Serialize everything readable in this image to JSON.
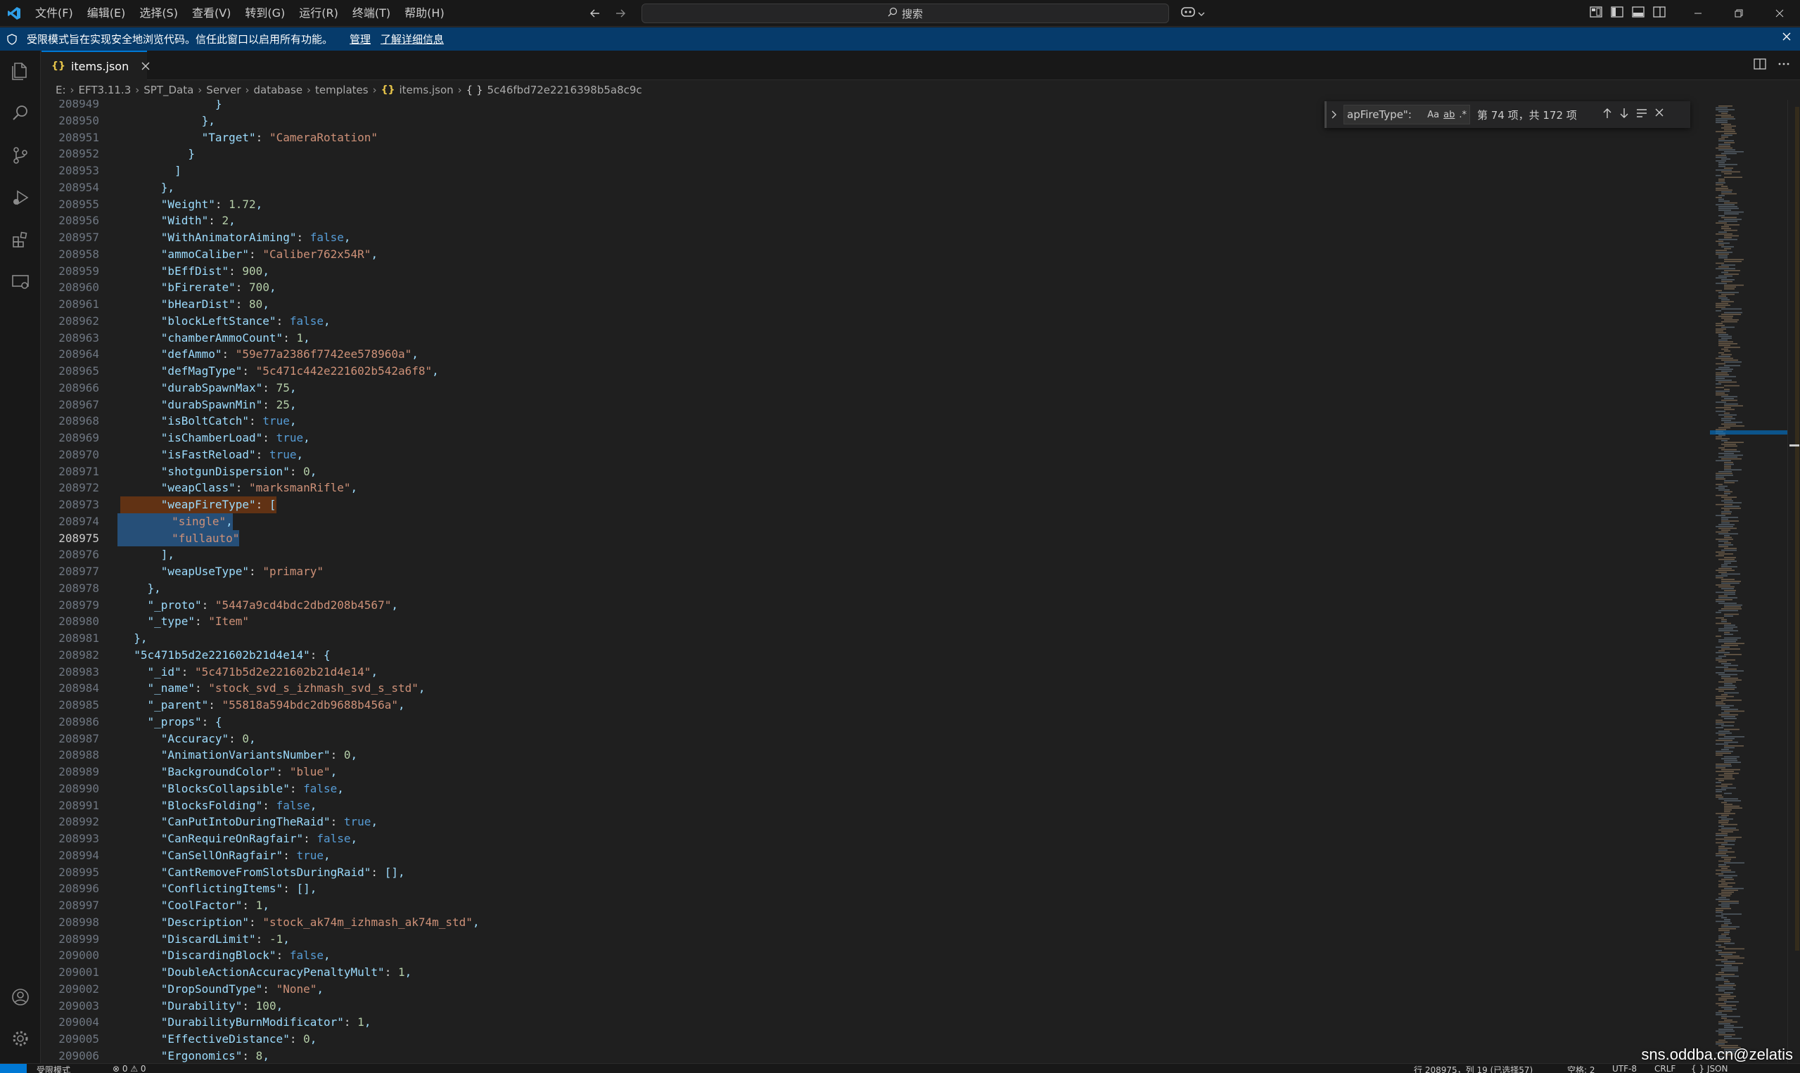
{
  "titlebar": {
    "menu": [
      "文件(F)",
      "编辑(E)",
      "选择(S)",
      "查看(V)",
      "转到(G)",
      "运行(R)",
      "终端(T)",
      "帮助(H)"
    ],
    "search_label": "搜索"
  },
  "banner": {
    "message": "受限模式旨在实现安全地浏览代码。信任此窗口以启用所有功能。",
    "manage": "管理",
    "learn_more": "了解详细信息"
  },
  "tab": {
    "label": "items.json"
  },
  "breadcrumb": {
    "items": [
      "E:",
      "EFT3.11.3",
      "SPT_Data",
      "Server",
      "database",
      "templates",
      "items.json",
      "5c46fbd72e2216398b5a8c9c"
    ]
  },
  "find": {
    "query": "apFireType\":",
    "options": [
      "Aa",
      "ab",
      ".*"
    ],
    "count": "第 74 项，共 172 项"
  },
  "editor": {
    "current_line": "208975",
    "lines": [
      {
        "n": "208949",
        "t": "              }"
      },
      {
        "n": "208950",
        "t": "            },"
      },
      {
        "n": "208951",
        "t": "            \"Target\": \"CameraRotation\""
      },
      {
        "n": "208952",
        "t": "          }"
      },
      {
        "n": "208953",
        "t": "        ]"
      },
      {
        "n": "208954",
        "t": "      },"
      },
      {
        "n": "208955",
        "t": "      \"Weight\": 1.72,"
      },
      {
        "n": "208956",
        "t": "      \"Width\": 2,"
      },
      {
        "n": "208957",
        "t": "      \"WithAnimatorAiming\": false,"
      },
      {
        "n": "208958",
        "t": "      \"ammoCaliber\": \"Caliber762x54R\","
      },
      {
        "n": "208959",
        "t": "      \"bEffDist\": 900,"
      },
      {
        "n": "208960",
        "t": "      \"bFirerate\": 700,"
      },
      {
        "n": "208961",
        "t": "      \"bHearDist\": 80,"
      },
      {
        "n": "208962",
        "t": "      \"blockLeftStance\": false,"
      },
      {
        "n": "208963",
        "t": "      \"chamberAmmoCount\": 1,"
      },
      {
        "n": "208964",
        "t": "      \"defAmmo\": \"59e77a2386f7742ee578960a\","
      },
      {
        "n": "208965",
        "t": "      \"defMagType\": \"5c471c442e221602b542a6f8\","
      },
      {
        "n": "208966",
        "t": "      \"durabSpawnMax\": 75,"
      },
      {
        "n": "208967",
        "t": "      \"durabSpawnMin\": 25,"
      },
      {
        "n": "208968",
        "t": "      \"isBoltCatch\": true,"
      },
      {
        "n": "208969",
        "t": "      \"isChamberLoad\": true,"
      },
      {
        "n": "208970",
        "t": "      \"isFastReload\": true,"
      },
      {
        "n": "208971",
        "t": "      \"shotgunDispersion\": 0,"
      },
      {
        "n": "208972",
        "t": "      \"weapClass\": \"marksmanRifle\","
      },
      {
        "n": "208973",
        "t": "      \"weapFireType\": ["
      },
      {
        "n": "208974",
        "t": "        \"single\","
      },
      {
        "n": "208975",
        "t": "        \"fullauto\""
      },
      {
        "n": "208976",
        "t": "      ],"
      },
      {
        "n": "208977",
        "t": "      \"weapUseType\": \"primary\""
      },
      {
        "n": "208978",
        "t": "    },"
      },
      {
        "n": "208979",
        "t": "    \"_proto\": \"5447a9cd4bdc2dbd208b4567\","
      },
      {
        "n": "208980",
        "t": "    \"_type\": \"Item\""
      },
      {
        "n": "208981",
        "t": "  },"
      },
      {
        "n": "208982",
        "t": "  \"5c471b5d2e221602b21d4e14\": {"
      },
      {
        "n": "208983",
        "t": "    \"_id\": \"5c471b5d2e221602b21d4e14\","
      },
      {
        "n": "208984",
        "t": "    \"_name\": \"stock_svd_s_izhmash_svd_s_std\","
      },
      {
        "n": "208985",
        "t": "    \"_parent\": \"55818a594bdc2db9688b456a\","
      },
      {
        "n": "208986",
        "t": "    \"_props\": {"
      },
      {
        "n": "208987",
        "t": "      \"Accuracy\": 0,"
      },
      {
        "n": "208988",
        "t": "      \"AnimationVariantsNumber\": 0,"
      },
      {
        "n": "208989",
        "t": "      \"BackgroundColor\": \"blue\","
      },
      {
        "n": "208990",
        "t": "      \"BlocksCollapsible\": false,"
      },
      {
        "n": "208991",
        "t": "      \"BlocksFolding\": false,"
      },
      {
        "n": "208992",
        "t": "      \"CanPutIntoDuringTheRaid\": true,"
      },
      {
        "n": "208993",
        "t": "      \"CanRequireOnRagfair\": false,"
      },
      {
        "n": "208994",
        "t": "      \"CanSellOnRagfair\": true,"
      },
      {
        "n": "208995",
        "t": "      \"CantRemoveFromSlotsDuringRaid\": [],"
      },
      {
        "n": "208996",
        "t": "      \"ConflictingItems\": [],"
      },
      {
        "n": "208997",
        "t": "      \"CoolFactor\": 1,"
      },
      {
        "n": "208998",
        "t": "      \"Description\": \"stock_ak74m_izhmash_ak74m_std\","
      },
      {
        "n": "208999",
        "t": "      \"DiscardLimit\": -1,"
      },
      {
        "n": "209000",
        "t": "      \"DiscardingBlock\": false,"
      },
      {
        "n": "209001",
        "t": "      \"DoubleActionAccuracyPenaltyMult\": 1,"
      },
      {
        "n": "209002",
        "t": "      \"DropSoundType\": \"None\","
      },
      {
        "n": "209003",
        "t": "      \"Durability\": 100,"
      },
      {
        "n": "209004",
        "t": "      \"DurabilityBurnModificator\": 1,"
      },
      {
        "n": "209005",
        "t": "      \"EffectiveDistance\": 0,"
      },
      {
        "n": "209006",
        "t": "      \"Ergonomics\": 8,"
      }
    ]
  },
  "statusbar": {
    "restricted": "受限模式",
    "problems": "⊗ 0 ⚠ 0",
    "position": "行 208975，列 19 (已选择57)",
    "spaces": "空格: 2",
    "encoding": "UTF-8",
    "eol": "CRLF",
    "language": "{ } JSON"
  },
  "watermark": "sns.oddba.cn@zelatis",
  "colors": {
    "accent": "#0078d4",
    "banner": "#063b6b",
    "selection": "#264f78",
    "find_highlight": "#613214"
  }
}
